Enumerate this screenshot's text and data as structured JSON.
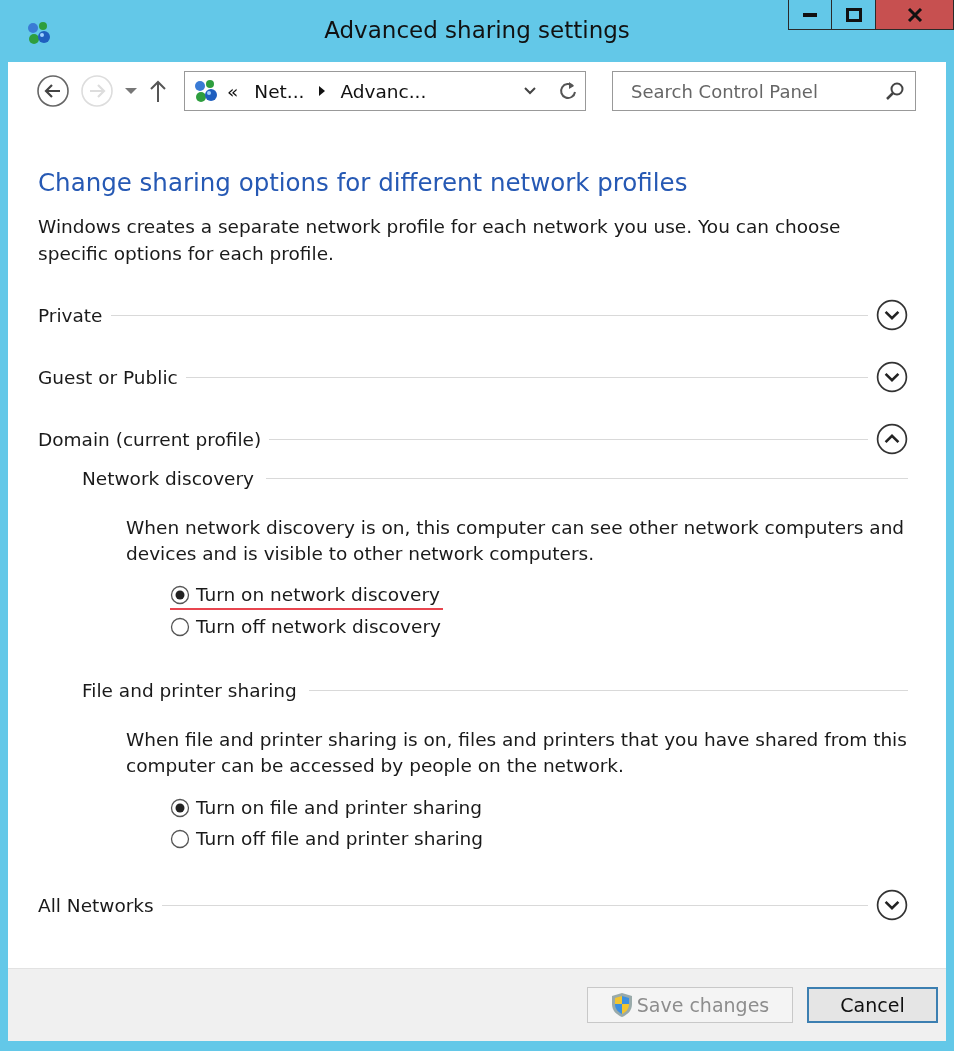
{
  "window": {
    "title": "Advanced sharing settings"
  },
  "address_bar": {
    "crumbs": [
      "«",
      "Net...",
      "Advanc..."
    ]
  },
  "search": {
    "placeholder": "Search Control Panel"
  },
  "heading": "Change sharing options for different network profiles",
  "description": "Windows creates a separate network profile for each network you use. You can choose specific options for each profile.",
  "profiles": [
    {
      "label": "Private",
      "expanded": false
    },
    {
      "label": "Guest or Public",
      "expanded": false
    },
    {
      "label": "Domain (current profile)",
      "expanded": true,
      "groups": [
        {
          "title": "Network discovery",
          "description": "When network discovery is on, this computer can see other network computers and devices and is visible to other network computers.",
          "options": [
            {
              "label": "Turn on network discovery",
              "selected": true,
              "underlined": true
            },
            {
              "label": "Turn off network discovery",
              "selected": false,
              "underlined": false
            }
          ]
        },
        {
          "title": "File and printer sharing",
          "description": "When file and printer sharing is on, files and printers that you have shared from this computer can be accessed by people on the network.",
          "options": [
            {
              "label": "Turn on file and printer sharing",
              "selected": true,
              "underlined": false
            },
            {
              "label": "Turn off file and printer sharing",
              "selected": false,
              "underlined": false
            }
          ]
        }
      ]
    },
    {
      "label": "All Networks",
      "expanded": false
    }
  ],
  "buttons": [
    {
      "label": "Save changes",
      "kind": "shield",
      "disabled": true,
      "focused": false
    },
    {
      "label": "Cancel",
      "kind": "plain",
      "disabled": false,
      "focused": true
    }
  ]
}
